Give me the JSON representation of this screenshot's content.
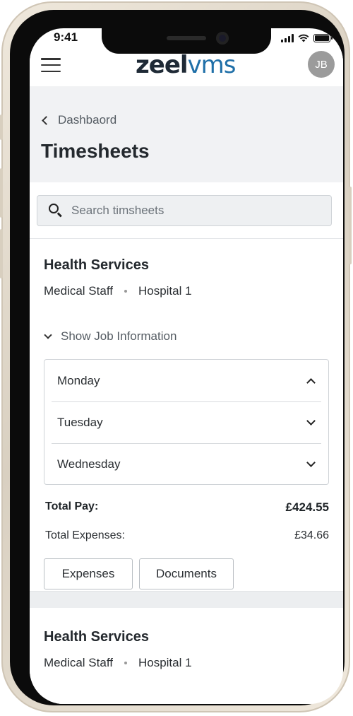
{
  "status_bar": {
    "time": "9:41"
  },
  "header": {
    "logo_part1": "zeel",
    "logo_part2": "vms",
    "avatar_initials": "JB"
  },
  "breadcrumb": {
    "label": "Dashbaord"
  },
  "page": {
    "title": "Timesheets"
  },
  "search": {
    "placeholder": "Search timsheets",
    "value": ""
  },
  "cards": [
    {
      "title": "Health Services",
      "role": "Medical Staff",
      "location": "Hospital 1",
      "toggle_label": "Show Job Information",
      "days": [
        {
          "label": "Monday",
          "expanded": true
        },
        {
          "label": "Tuesday",
          "expanded": false
        },
        {
          "label": "Wednesday",
          "expanded": false
        }
      ],
      "total_pay_label": "Total Pay:",
      "total_pay_value": "£424.55",
      "total_expenses_label": "Total Expenses:",
      "total_expenses_value": "£34.66",
      "buttons": {
        "expenses": "Expenses",
        "documents": "Documents"
      }
    },
    {
      "title": "Health Services",
      "role": "Medical Staff",
      "location": "Hospital 1"
    }
  ],
  "colors": {
    "logo_dark": "#1f2a36",
    "logo_blue": "#1f6fa8",
    "title_band": "#f1f2f4",
    "avatar": "#9b9b9b"
  }
}
